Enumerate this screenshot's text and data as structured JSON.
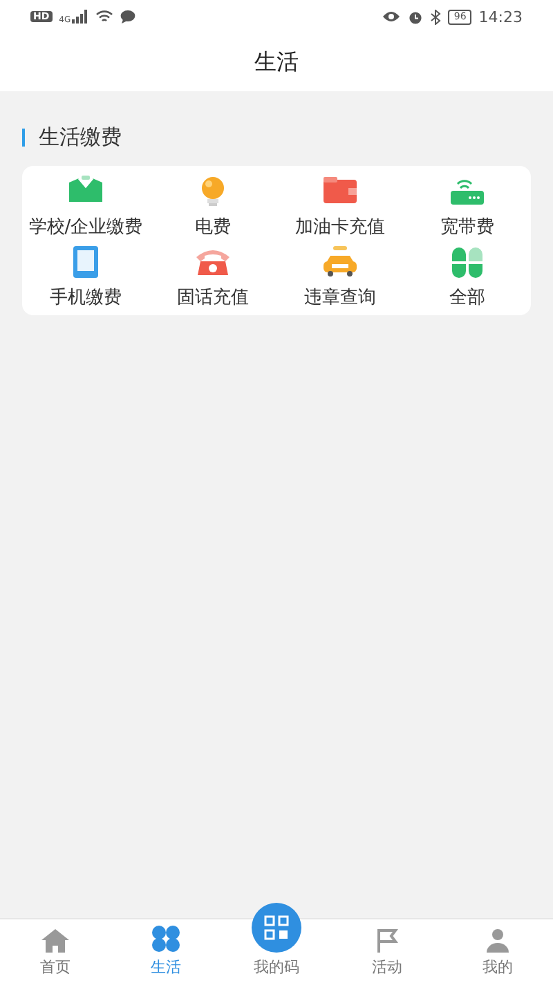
{
  "status_bar": {
    "left": "HD",
    "network": "4G",
    "battery": "96",
    "time": "14:23"
  },
  "header": {
    "title": "生活"
  },
  "section": {
    "title": "生活缴费",
    "items": [
      {
        "label": "学校/企业缴费",
        "kind": "school"
      },
      {
        "label": "电费",
        "kind": "bulb"
      },
      {
        "label": "加油卡充值",
        "kind": "wallet"
      },
      {
        "label": "宽带费",
        "kind": "router"
      },
      {
        "label": "手机缴费",
        "kind": "phone"
      },
      {
        "label": "固话充值",
        "kind": "telephone"
      },
      {
        "label": "违章查询",
        "kind": "car"
      },
      {
        "label": "全部",
        "kind": "all"
      }
    ]
  },
  "tab_bar": [
    {
      "label": "首页",
      "kind": "home",
      "selected": false
    },
    {
      "label": "生活",
      "kind": "life",
      "selected": true
    },
    {
      "label": "我的码",
      "kind": "code",
      "selected": false
    },
    {
      "label": "活动",
      "kind": "activity",
      "selected": false
    },
    {
      "label": "我的",
      "kind": "me",
      "selected": false
    }
  ]
}
